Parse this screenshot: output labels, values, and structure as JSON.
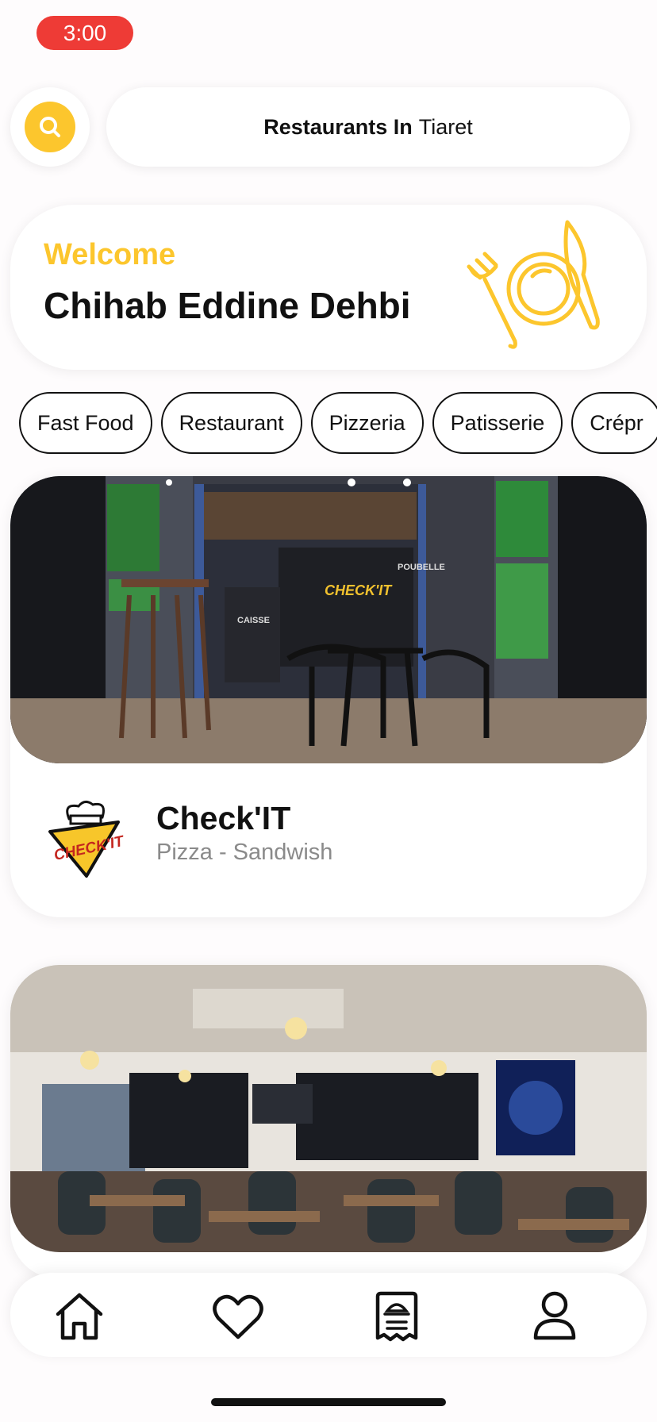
{
  "status_bar": {
    "time": "3:00"
  },
  "header": {
    "search_icon": "search-icon",
    "location_prefix": "Restaurants In",
    "location_city": "Tiaret"
  },
  "welcome": {
    "label": "Welcome",
    "user_name": "Chihab Eddine Dehbi",
    "illustration": "plate-fork-knife-icon"
  },
  "categories": [
    {
      "label": "Fast Food"
    },
    {
      "label": "Restaurant"
    },
    {
      "label": "Pizzeria"
    },
    {
      "label": "Patisserie"
    },
    {
      "label": "Crépr"
    }
  ],
  "restaurants": [
    {
      "name": "Check'IT",
      "tags": "Pizza - Sandwish",
      "logo": "CHECK'IT",
      "photo_signs": [
        "CAISSE",
        "POUBELLE"
      ]
    },
    {
      "name": "",
      "tags": ""
    }
  ],
  "bottom_nav": [
    {
      "icon": "home-icon"
    },
    {
      "icon": "heart-icon"
    },
    {
      "icon": "receipt-icon"
    },
    {
      "icon": "profile-icon"
    }
  ],
  "colors": {
    "accent": "#fcc62d",
    "status_time_bg": "#ee3b36",
    "text_dark": "#111111",
    "text_muted": "#8a8a8a"
  }
}
